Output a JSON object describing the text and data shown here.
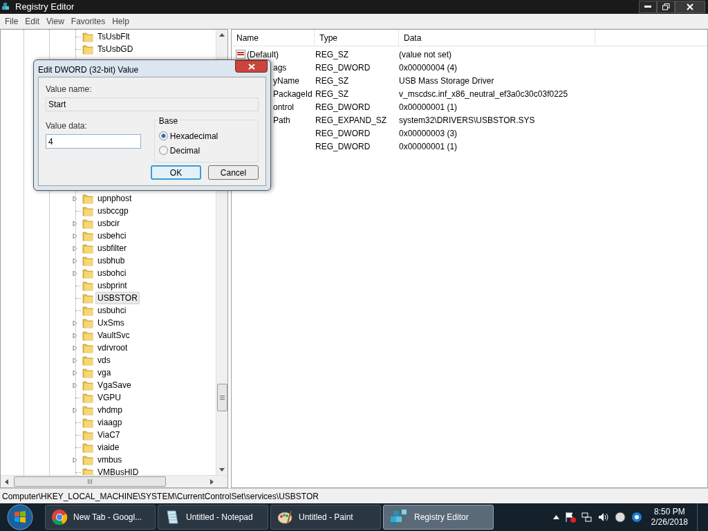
{
  "window": {
    "title": "Registry Editor"
  },
  "menu": [
    "File",
    "Edit",
    "View",
    "Favorites",
    "Help"
  ],
  "tree": {
    "top": [
      {
        "label": "TsUsbFlt",
        "expandable": false,
        "selected": false
      },
      {
        "label": "TsUsbGD",
        "expandable": false,
        "selected": false
      }
    ],
    "bottom": [
      {
        "label": "upnphost",
        "expandable": true,
        "selected": false
      },
      {
        "label": "usbccgp",
        "expandable": false,
        "selected": false
      },
      {
        "label": "usbcir",
        "expandable": true,
        "selected": false
      },
      {
        "label": "usbehci",
        "expandable": true,
        "selected": false
      },
      {
        "label": "usbfilter",
        "expandable": true,
        "selected": false
      },
      {
        "label": "usbhub",
        "expandable": true,
        "selected": false
      },
      {
        "label": "usbohci",
        "expandable": true,
        "selected": false
      },
      {
        "label": "usbprint",
        "expandable": false,
        "selected": false
      },
      {
        "label": "USBSTOR",
        "expandable": false,
        "selected": true
      },
      {
        "label": "usbuhci",
        "expandable": false,
        "selected": false
      },
      {
        "label": "UxSms",
        "expandable": true,
        "selected": false
      },
      {
        "label": "VaultSvc",
        "expandable": true,
        "selected": false
      },
      {
        "label": "vdrvroot",
        "expandable": true,
        "selected": false
      },
      {
        "label": "vds",
        "expandable": true,
        "selected": false
      },
      {
        "label": "vga",
        "expandable": true,
        "selected": false
      },
      {
        "label": "VgaSave",
        "expandable": true,
        "selected": false
      },
      {
        "label": "VGPU",
        "expandable": false,
        "selected": false
      },
      {
        "label": "vhdmp",
        "expandable": true,
        "selected": false
      },
      {
        "label": "viaagp",
        "expandable": false,
        "selected": false
      },
      {
        "label": "ViaC7",
        "expandable": false,
        "selected": false
      },
      {
        "label": "viaide",
        "expandable": false,
        "selected": false
      },
      {
        "label": "vmbus",
        "expandable": true,
        "selected": false
      },
      {
        "label": "VMBusHID",
        "expandable": false,
        "selected": false
      }
    ]
  },
  "list": {
    "columns": [
      "Name",
      "Type",
      "Data"
    ],
    "rows": [
      {
        "kind": "full",
        "name": "(Default)",
        "type": "REG_SZ",
        "data": "(value not set)"
      },
      {
        "kind": "clipped",
        "name": "ags",
        "type": "REG_DWORD",
        "data": "0x00000004 (4)"
      },
      {
        "kind": "clipped",
        "name": "yName",
        "type": "REG_SZ",
        "data": "USB Mass Storage Driver"
      },
      {
        "kind": "clipped",
        "name": "PackageId",
        "type": "REG_SZ",
        "data": "v_mscdsc.inf_x86_neutral_ef3a0c30c03f0225"
      },
      {
        "kind": "clipped",
        "name": "ontrol",
        "type": "REG_DWORD",
        "data": "0x00000001 (1)"
      },
      {
        "kind": "clipped",
        "name": "Path",
        "type": "REG_EXPAND_SZ",
        "data": "system32\\DRIVERS\\USBSTOR.SYS"
      },
      {
        "kind": "hidden",
        "type": "REG_DWORD",
        "data": "0x00000003 (3)"
      },
      {
        "kind": "hidden",
        "type": "REG_DWORD",
        "data": "0x00000001 (1)"
      }
    ]
  },
  "status_bar": "Computer\\HKEY_LOCAL_MACHINE\\SYSTEM\\CurrentControlSet\\services\\USBSTOR",
  "dialog": {
    "title": "Edit DWORD (32-bit) Value",
    "value_name_label": "Value name:",
    "value_name": "Start",
    "value_data_label": "Value data:",
    "value_data": "4",
    "base_label": "Base",
    "options": [
      {
        "label": "Hexadecimal",
        "selected": true
      },
      {
        "label": "Decimal",
        "selected": false
      }
    ],
    "buttons": [
      {
        "label": "OK",
        "default": true
      },
      {
        "label": "Cancel",
        "default": false
      }
    ]
  },
  "taskbar": {
    "buttons": [
      {
        "kind": "browser",
        "label": "New Tab - Googl...",
        "selected": false
      },
      {
        "kind": "notepad",
        "label": "Untitled - Notepad",
        "selected": false
      },
      {
        "kind": "paint",
        "label": "Untitled - Paint",
        "selected": false
      },
      {
        "kind": "registry",
        "label": "Registry Editor",
        "selected": true
      }
    ],
    "time": "8:50 PM",
    "date": "2/26/2018"
  }
}
